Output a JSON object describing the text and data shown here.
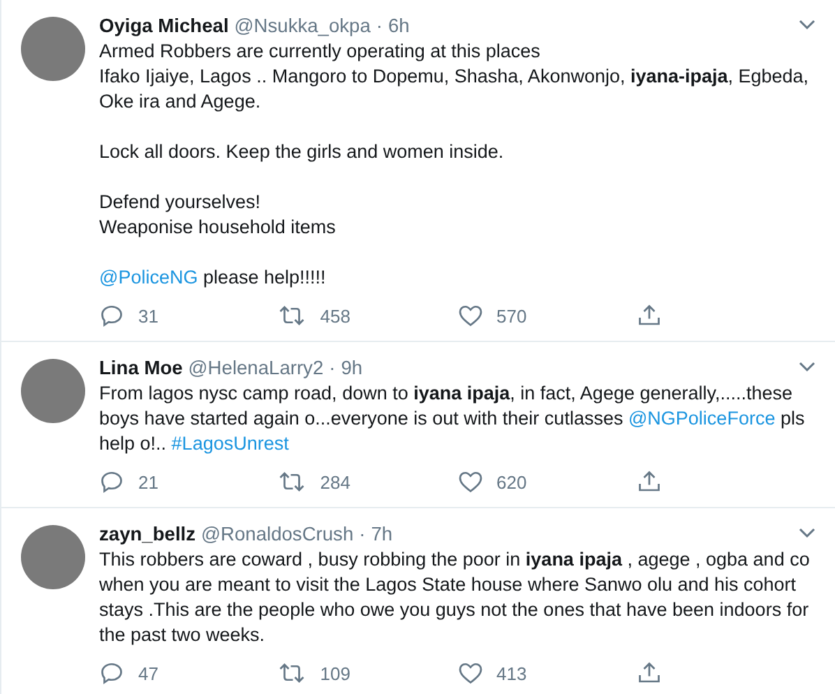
{
  "tweets": [
    {
      "name": "Oyiga Micheal",
      "handle": "@Nsukka_okpa",
      "separator": "·",
      "time": "6h",
      "paragraphs": [
        [
          {
            "kind": "text",
            "text": "Armed Robbers are currently operating at this places\nIfako Ijaiye, Lagos .. Mangoro to Dopemu, Shasha, Akonwonjo, **iyana-ipaja**, Egbeda, Oke ira and Agege."
          }
        ],
        [
          {
            "kind": "text",
            "text": "Lock all doors. Keep the girls and women inside."
          }
        ],
        [
          {
            "kind": "text",
            "text": "Defend yourselves!\nWeaponise household items"
          }
        ],
        [
          {
            "kind": "link",
            "text": "@PoliceNG"
          },
          {
            "kind": "text",
            "text": " please help!!!!!"
          }
        ]
      ],
      "replies": "31",
      "retweets": "458",
      "likes": "570"
    },
    {
      "name": "Lina Moe",
      "handle": "@HelenaLarry2",
      "separator": "·",
      "time": "9h",
      "paragraphs": [
        [
          {
            "kind": "text",
            "text": "From lagos nysc camp road, down to **iyana ipaja**, in fact, Agege generally,.....these boys have started again o...everyone is out with their cutlasses "
          },
          {
            "kind": "link",
            "text": "@NGPoliceForce"
          },
          {
            "kind": "text",
            "text": " pls help o!.. "
          },
          {
            "kind": "link",
            "text": "#LagosUnrest"
          }
        ]
      ],
      "replies": "21",
      "retweets": "284",
      "likes": "620"
    },
    {
      "name": "zayn_bellz",
      "handle": "@RonaldosCrush",
      "separator": "·",
      "time": "7h",
      "paragraphs": [
        [
          {
            "kind": "text",
            "text": "This robbers are coward , busy robbing the poor in **iyana ipaja** , agege , ogba and co when you are meant to visit the Lagos State house where Sanwo olu and his cohort stays .This are the people who owe you guys not the ones that have been indoors for the past two weeks."
          }
        ]
      ],
      "replies": "47",
      "retweets": "109",
      "likes": "413"
    }
  ]
}
